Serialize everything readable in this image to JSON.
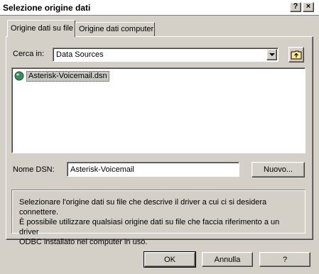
{
  "window": {
    "title": "Selezione origine dati",
    "help_glyph": "?",
    "close_glyph": "×"
  },
  "tabs": [
    {
      "label": "Origine dati su file",
      "active": true
    },
    {
      "label": "Origine dati computer",
      "active": false
    }
  ],
  "look_in": {
    "label": "Cerca in:",
    "value": "Data Sources"
  },
  "files": [
    {
      "name": "Asterisk-Voicemail.dsn",
      "icon": "dsn-file-icon",
      "selected": true
    }
  ],
  "dsn_name": {
    "label": "Nome DSN:",
    "value": "Asterisk-Voicemail",
    "new_button": "Nuovo..."
  },
  "info_text": {
    "line1": "Selezionare l'origine dati su file che descrive il driver a cui ci si desidera connettere.",
    "line2": "È possibile utilizzare qualsiasi origine dati su file che faccia riferimento a un driver",
    "line3": "ODBC installato nel computer in uso."
  },
  "buttons": {
    "ok": "OK",
    "cancel": "Annulla",
    "help": "?"
  },
  "colors": {
    "face": "#d4d0c8",
    "selection": "#c9c7c2"
  }
}
